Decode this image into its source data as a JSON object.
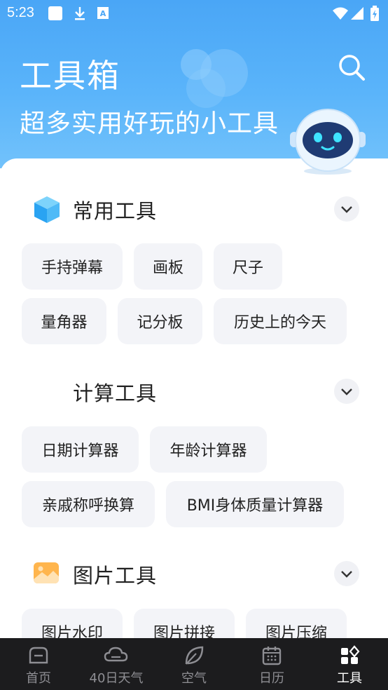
{
  "status_bar": {
    "time": "5:23"
  },
  "header": {
    "title": "工具箱",
    "subtitle": "超多实用好玩的小工具"
  },
  "sections": [
    {
      "title": "常用工具",
      "icon": "cube-icon",
      "tools": [
        "手持弹幕",
        "画板",
        "尺子",
        "量角器",
        "记分板",
        "历史上的今天"
      ]
    },
    {
      "title": "计算工具",
      "icon": "calculator-icon",
      "tools": [
        "日期计算器",
        "年龄计算器",
        "亲戚称呼换算",
        "BMI身体质量计算器"
      ]
    },
    {
      "title": "图片工具",
      "icon": "image-icon",
      "tools": [
        "图片水印",
        "图片拼接",
        "图片压缩"
      ]
    }
  ],
  "nav": {
    "items": [
      {
        "label": "首页",
        "icon": "home-icon"
      },
      {
        "label": "40日天气",
        "icon": "cloud-icon"
      },
      {
        "label": "空气",
        "icon": "leaf-icon"
      },
      {
        "label": "日历",
        "icon": "calendar-icon"
      },
      {
        "label": "工具",
        "icon": "tools-grid-icon"
      }
    ],
    "active": "工具"
  },
  "colors": {
    "header_blue": "#4aa6f6",
    "chip_bg": "#f3f4f8",
    "nav_bg": "#1c1c1e"
  }
}
